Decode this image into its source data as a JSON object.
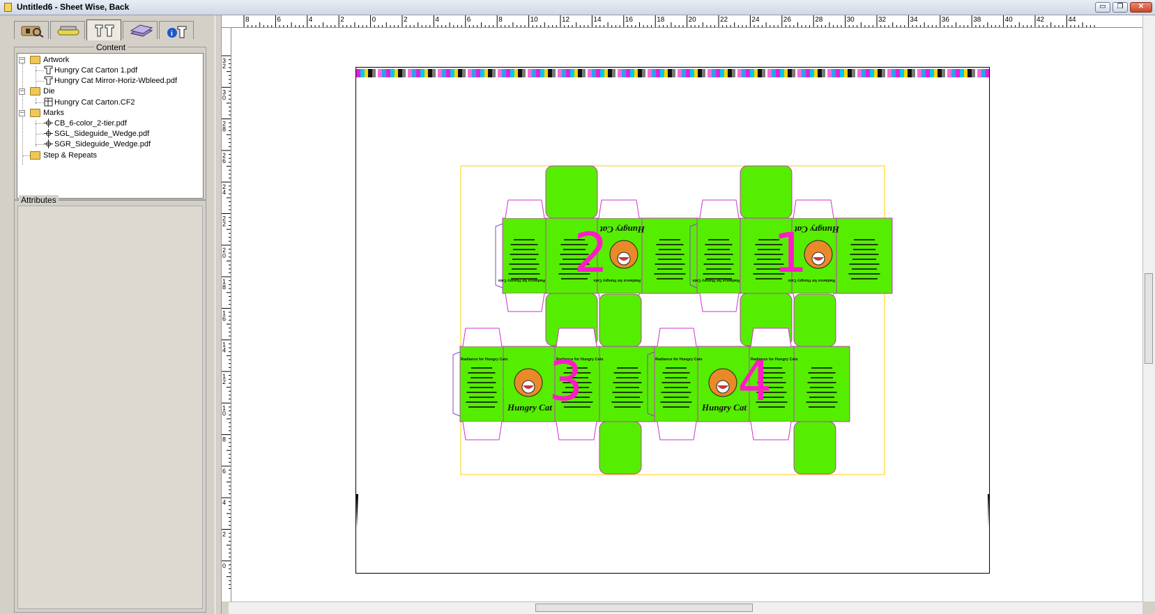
{
  "window": {
    "title": "Untitled6 - Sheet Wise, Back",
    "minimize_icon": "minimize-icon",
    "maximize_icon": "maximize-icon",
    "close_icon": "close-icon"
  },
  "tabs": [
    {
      "icon": "job-info-icon",
      "active": false
    },
    {
      "icon": "press-icon",
      "active": false
    },
    {
      "icon": "content-icon",
      "active": true
    },
    {
      "icon": "sheet-layers-icon",
      "active": false
    },
    {
      "icon": "info-icon",
      "active": false
    }
  ],
  "content": {
    "legend": "Content",
    "tree": [
      {
        "label": "Artwork",
        "type": "folder",
        "expanded": true,
        "children": [
          {
            "label": "Hungry Cat Carton 1.pdf",
            "type": "artwork-file"
          },
          {
            "label": "Hungry Cat Mirror-Horiz-Wbleed.pdf",
            "type": "artwork-file"
          }
        ]
      },
      {
        "label": "Die",
        "type": "folder",
        "expanded": true,
        "children": [
          {
            "label": "Hungry Cat Carton.CF2",
            "type": "die-file"
          }
        ]
      },
      {
        "label": "Marks",
        "type": "folder",
        "expanded": true,
        "children": [
          {
            "label": "CB_6-color_2-tier.pdf",
            "type": "mark-file"
          },
          {
            "label": "SGL_Sideguide_Wedge.pdf",
            "type": "mark-file"
          },
          {
            "label": "SGR_Sideguide_Wedge.pdf",
            "type": "mark-file"
          }
        ]
      },
      {
        "label": "Step & Repeats",
        "type": "folder",
        "expanded": false,
        "children": []
      }
    ]
  },
  "attributes": {
    "legend": "Attributes"
  },
  "rulers": {
    "horizontal_ticks": [
      "8",
      "6",
      "4",
      "2",
      "0",
      "2",
      "4",
      "6",
      "8",
      "10",
      "12",
      "14",
      "16",
      "18",
      "20",
      "22",
      "24",
      "26",
      "28",
      "30",
      "32",
      "34",
      "36",
      "38",
      "40",
      "42",
      "44"
    ],
    "vertical_ticks": [
      "32",
      "30",
      "28",
      "26",
      "24",
      "22",
      "20",
      "18",
      "16",
      "14",
      "12",
      "10",
      "8",
      "6",
      "4",
      "2",
      "0"
    ]
  },
  "layout": {
    "panel_numbers": [
      "1",
      "2",
      "3",
      "4"
    ],
    "box_colors": {
      "fill": "#55ee00",
      "die_line": "#cc33cc",
      "bleed": "#ffcc00",
      "number": "#ff1ac6"
    },
    "brand_text": "Hungry Cat",
    "panel_heading": "Radiance for Hungry Cats"
  }
}
